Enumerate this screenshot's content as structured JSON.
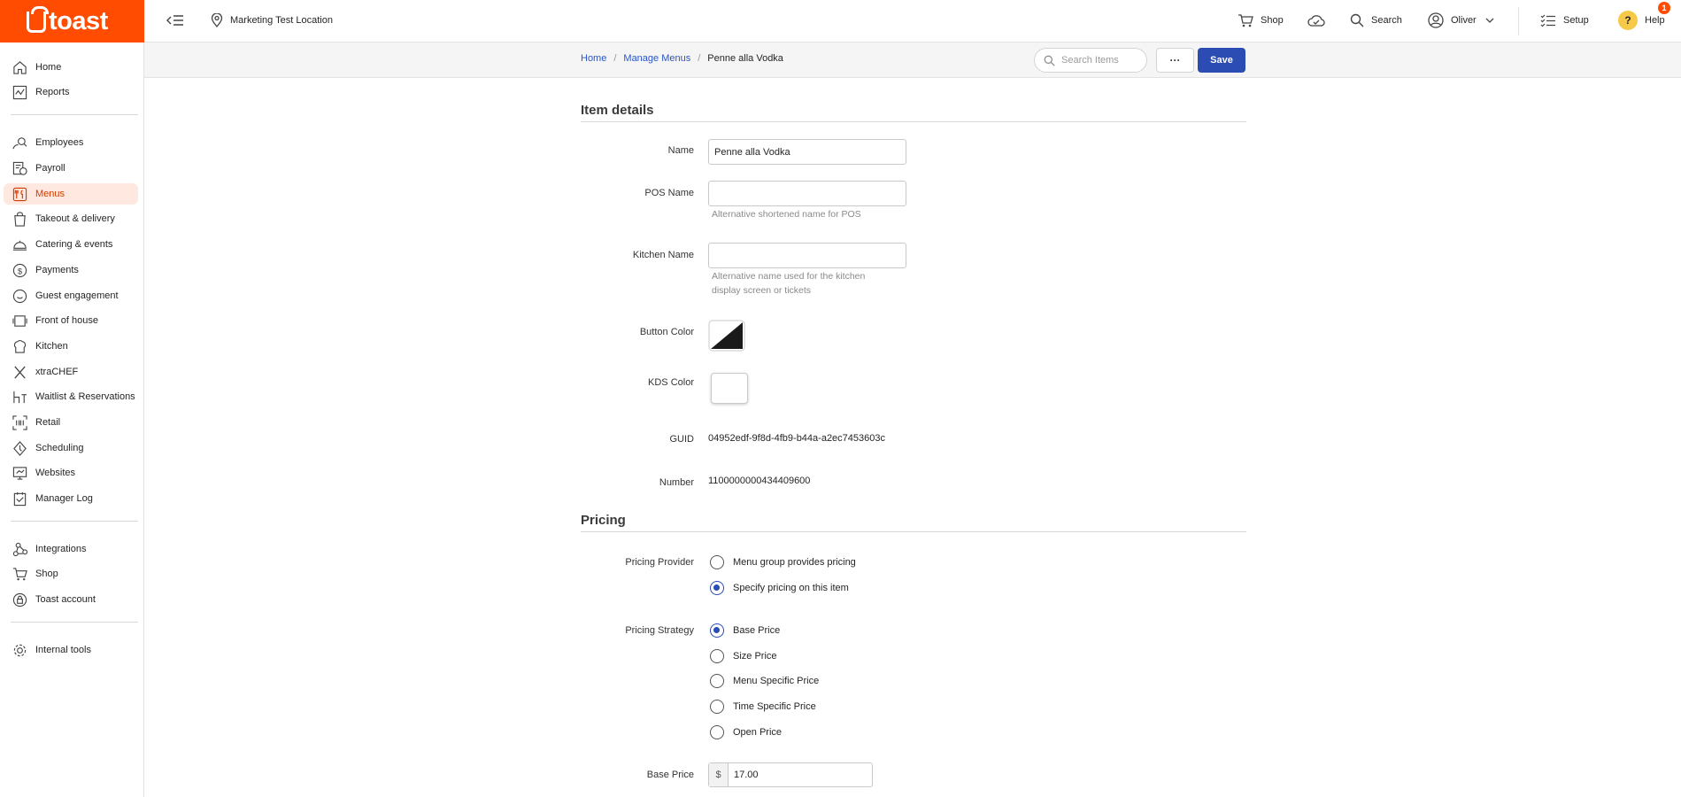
{
  "brand": {
    "logo_text": "toast",
    "accent": "#ff4c00",
    "primary_button": "#2a4cb3"
  },
  "topbar": {
    "location": "Marketing Test Location",
    "shop": "Shop",
    "search": "Search",
    "user": "Oliver",
    "setup": "Setup",
    "help": "Help",
    "help_badge": "1",
    "help_q": "?"
  },
  "sidebar": {
    "items": [
      {
        "label": "Home",
        "icon": "home-icon"
      },
      {
        "label": "Reports",
        "icon": "reports-icon"
      },
      {
        "label": "Employees",
        "icon": "employees-icon"
      },
      {
        "label": "Payroll",
        "icon": "payroll-icon"
      },
      {
        "label": "Menus",
        "icon": "menus-icon",
        "active": true
      },
      {
        "label": "Takeout & delivery",
        "icon": "takeout-icon"
      },
      {
        "label": "Catering & events",
        "icon": "catering-icon"
      },
      {
        "label": "Payments",
        "icon": "payments-icon"
      },
      {
        "label": "Guest engagement",
        "icon": "guest-icon"
      },
      {
        "label": "Front of house",
        "icon": "front-house-icon"
      },
      {
        "label": "Kitchen",
        "icon": "kitchen-icon"
      },
      {
        "label": "xtraCHEF",
        "icon": "xtrachef-icon"
      },
      {
        "label": "Waitlist & Reservations",
        "icon": "waitlist-icon"
      },
      {
        "label": "Retail",
        "icon": "retail-icon"
      },
      {
        "label": "Scheduling",
        "icon": "scheduling-icon"
      },
      {
        "label": "Websites",
        "icon": "websites-icon"
      },
      {
        "label": "Manager Log",
        "icon": "manager-log-icon"
      },
      {
        "label": "Integrations",
        "icon": "integrations-icon"
      },
      {
        "label": "Shop",
        "icon": "shop-icon"
      },
      {
        "label": "Toast account",
        "icon": "account-icon"
      },
      {
        "label": "Internal tools",
        "icon": "gear-icon"
      }
    ]
  },
  "subheader": {
    "breadcrumb": [
      "Home",
      "Manage Menus",
      "Penne alla Vodka"
    ],
    "breadcrumb_sep": "/",
    "search_placeholder": "Search Items",
    "more": "···",
    "save": "Save"
  },
  "item_details": {
    "title": "Item details",
    "name_label": "Name",
    "name_value": "Penne alla Vodka",
    "pos_name_label": "POS Name",
    "pos_name_value": "",
    "pos_name_hint": "Alternative shortened name for POS",
    "kitchen_name_label": "Kitchen Name",
    "kitchen_name_value": "",
    "kitchen_name_hint": "Alternative name used for the kitchen display screen or tickets",
    "button_color_label": "Button Color",
    "kds_color_label": "KDS Color",
    "guid_label": "GUID",
    "guid_value": "04952edf-9f8d-4fb9-b44a-a2ec7453603c",
    "number_label": "Number",
    "number_value": "1100000000434409600"
  },
  "pricing": {
    "title": "Pricing",
    "provider_label": "Pricing Provider",
    "provider_options": [
      {
        "label": "Menu group provides pricing",
        "selected": false
      },
      {
        "label": "Specify pricing on this item",
        "selected": true
      }
    ],
    "strategy_label": "Pricing Strategy",
    "strategy_options": [
      {
        "label": "Base Price",
        "selected": true
      },
      {
        "label": "Size Price",
        "selected": false
      },
      {
        "label": "Menu Specific Price",
        "selected": false
      },
      {
        "label": "Time Specific Price",
        "selected": false
      },
      {
        "label": "Open Price",
        "selected": false
      }
    ],
    "base_price_label": "Base Price",
    "currency": "$",
    "base_price_value": "17.00"
  }
}
